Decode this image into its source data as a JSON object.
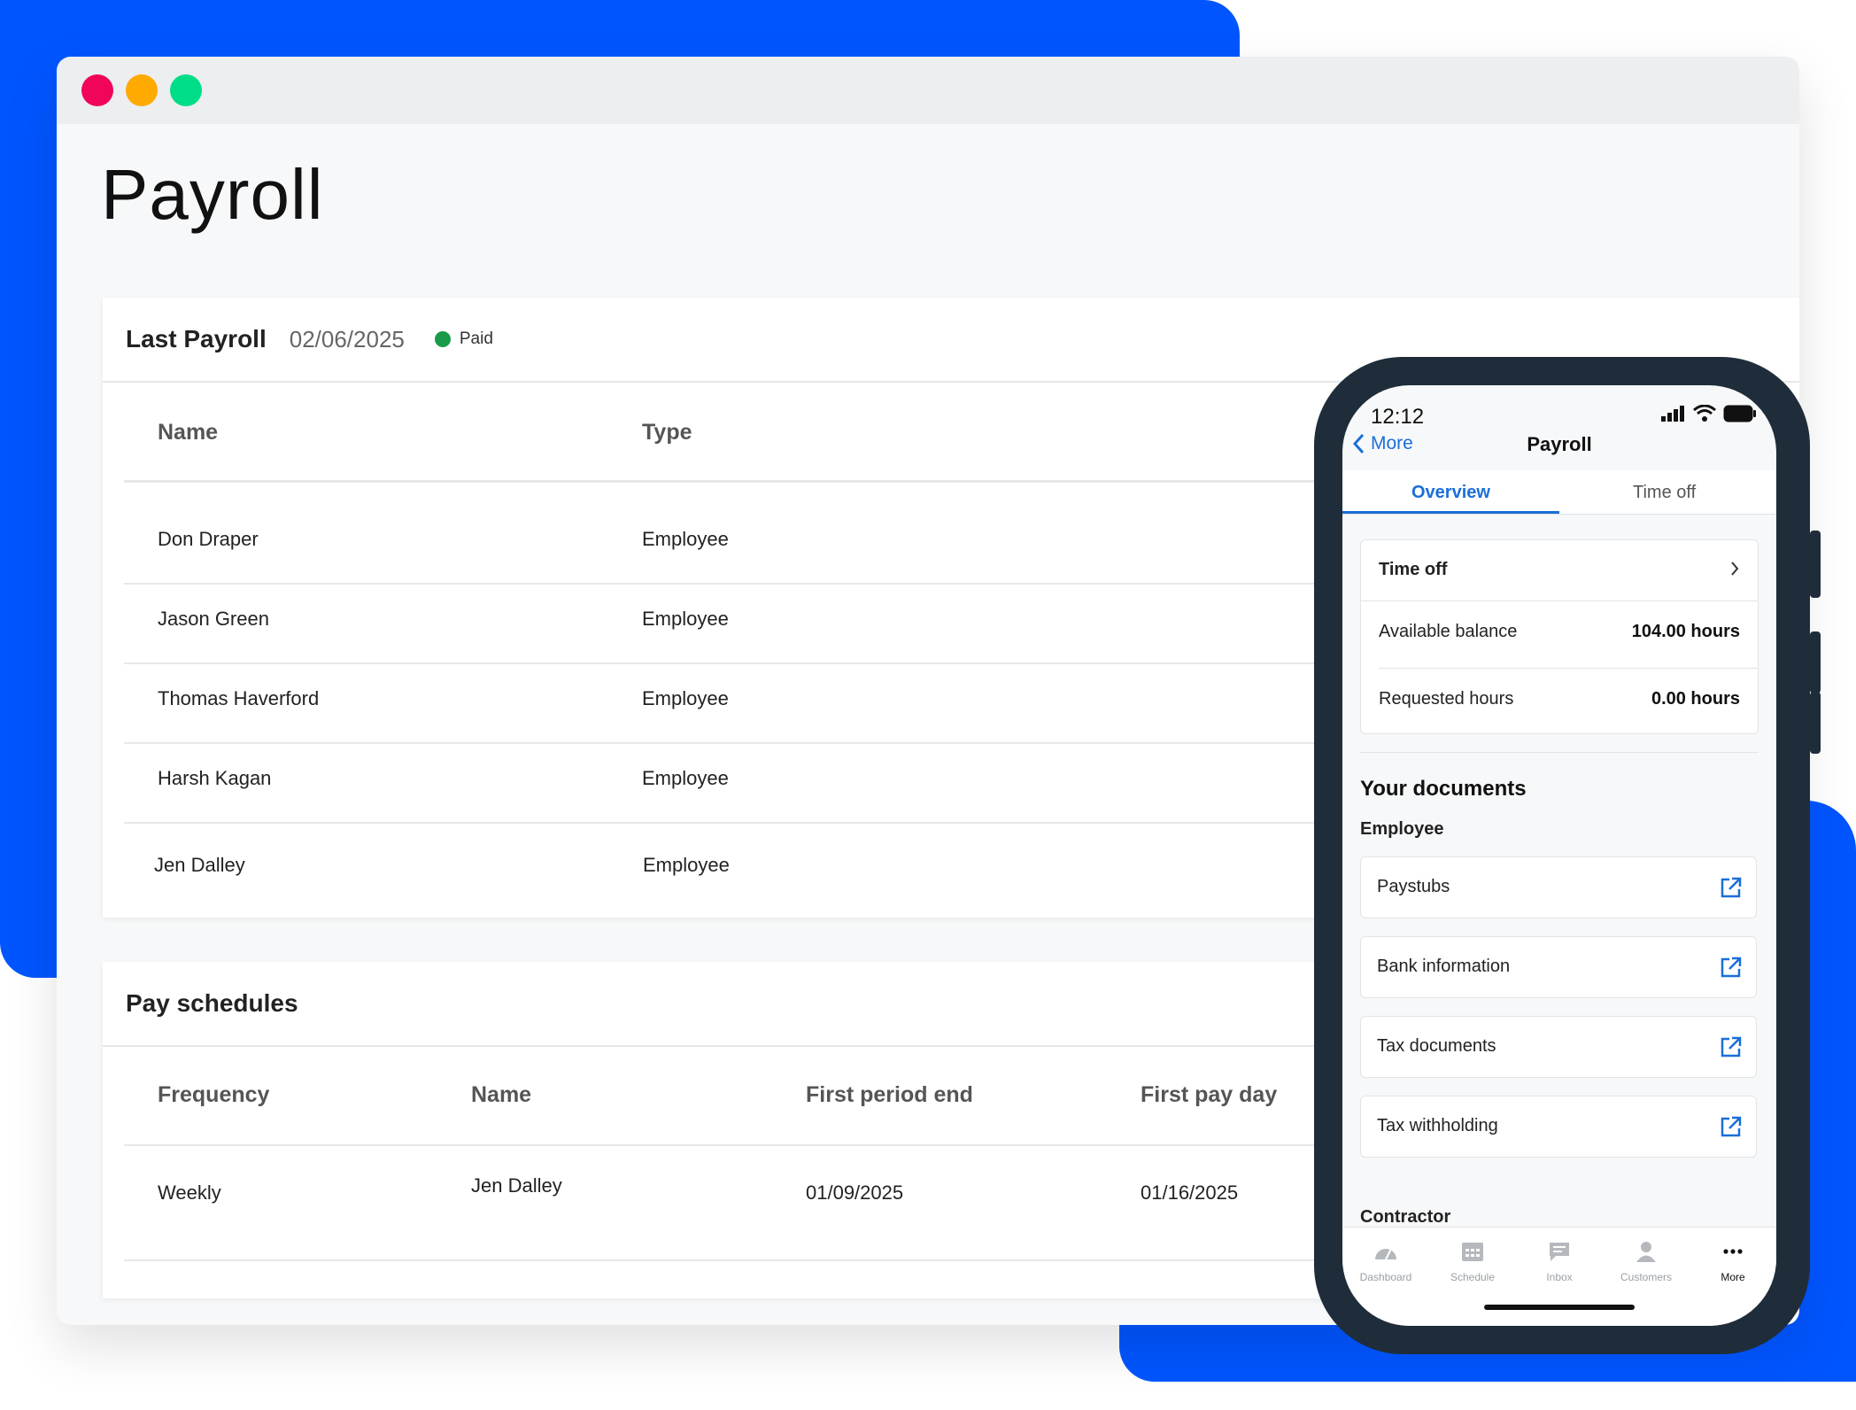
{
  "colors": {
    "brand_blue": "#0055ff",
    "dot_red": "#f0055a",
    "dot_yellow": "#ffaa00",
    "dot_green": "#00dd88",
    "paid_green": "#1a9a4a",
    "link_blue": "#1a6fd8"
  },
  "page": {
    "title": "Payroll"
  },
  "last_payroll": {
    "title": "Last Payroll",
    "date": "02/06/2025",
    "status": "Paid",
    "columns": [
      "Name",
      "Type"
    ],
    "rows": [
      {
        "name": "Don Draper",
        "type": "Employee"
      },
      {
        "name": "Jason Green",
        "type": "Employee"
      },
      {
        "name": "Thomas Haverford",
        "type": "Employee"
      },
      {
        "name": "Harsh Kagan",
        "type": "Employee"
      },
      {
        "name": "Jen Dalley",
        "type": "Employee"
      }
    ]
  },
  "pay_schedules": {
    "title": "Pay schedules",
    "columns": [
      "Frequency",
      "Name",
      "First period end",
      "First pay day"
    ],
    "rows": [
      {
        "frequency": "Weekly",
        "name": "Jen Dalley",
        "first_period_end": "01/09/2025",
        "first_pay_day": "01/16/2025"
      }
    ]
  },
  "phone": {
    "time": "12:12",
    "back_label": "More",
    "title": "Payroll",
    "tabs": [
      "Overview",
      "Time off"
    ],
    "time_off": {
      "title": "Time off",
      "available_label": "Available balance",
      "available_value": "104.00 hours",
      "requested_label": "Requested hours",
      "requested_value": "0.00 hours"
    },
    "documents": {
      "title": "Your documents",
      "employee_label": "Employee",
      "items": [
        "Paystubs",
        "Bank information",
        "Tax documents",
        "Tax withholding"
      ],
      "contractor_label": "Contractor"
    },
    "tabbar": [
      {
        "label": "Dashboard",
        "icon": "dashboard-icon"
      },
      {
        "label": "Schedule",
        "icon": "calendar-icon"
      },
      {
        "label": "Inbox",
        "icon": "chat-icon"
      },
      {
        "label": "Customers",
        "icon": "person-icon"
      },
      {
        "label": "More",
        "icon": "more-icon"
      }
    ]
  }
}
